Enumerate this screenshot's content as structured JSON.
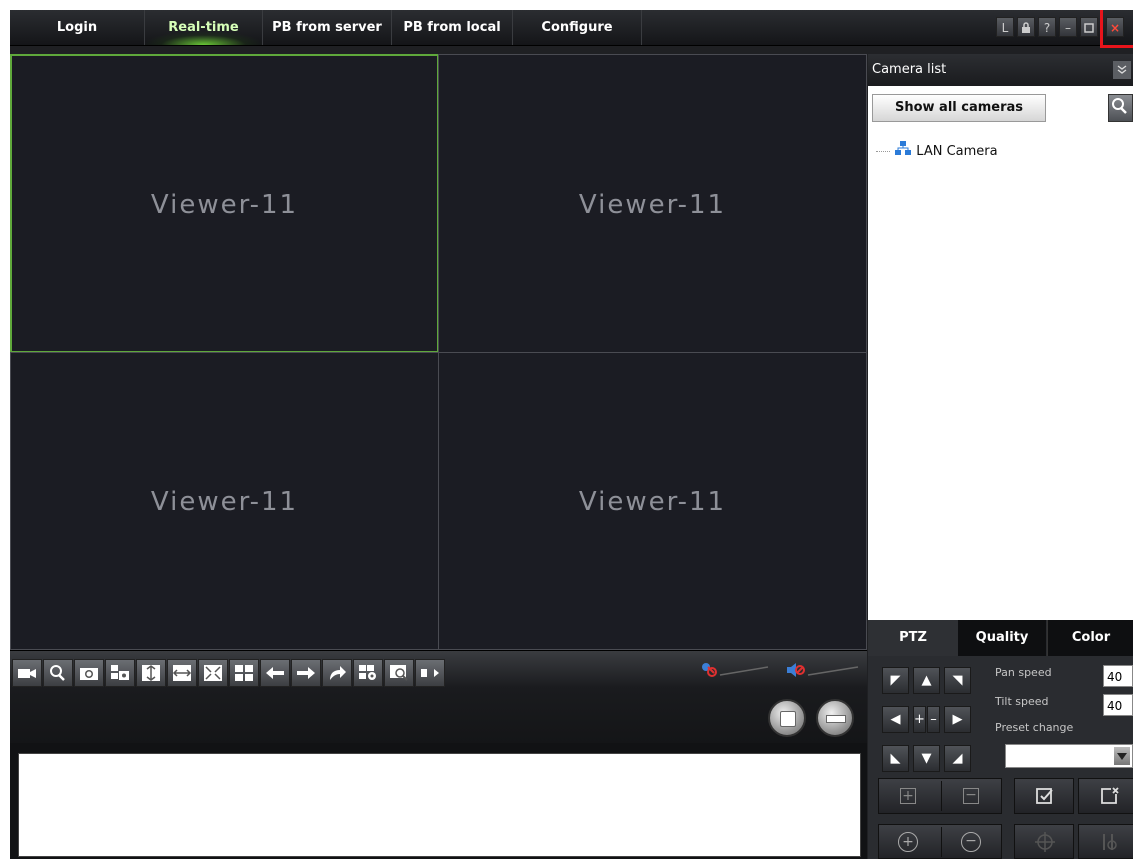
{
  "menu": {
    "tabs": [
      {
        "label": "Login"
      },
      {
        "label": "Real-time"
      },
      {
        "label": "PB from server"
      },
      {
        "label": "PB from local"
      },
      {
        "label": "Configure"
      }
    ],
    "active_tab": "Real-time",
    "window_buttons": {
      "lock_label": "L",
      "help_label": "?",
      "min_label": "–",
      "close_label": "×"
    }
  },
  "video": {
    "panes": [
      {
        "label": "Viewer-11",
        "selected": true
      },
      {
        "label": "Viewer-11",
        "selected": false
      },
      {
        "label": "Viewer-11",
        "selected": false
      },
      {
        "label": "Viewer-11",
        "selected": false
      }
    ]
  },
  "camera_list": {
    "title": "Camera list",
    "show_all_label": "Show all cameras",
    "tree": [
      {
        "label": "LAN Camera"
      }
    ]
  },
  "panel_tabs": [
    {
      "label": "PTZ"
    },
    {
      "label": "Quality"
    },
    {
      "label": "Color"
    }
  ],
  "ptz": {
    "pan_speed_label": "Pan speed",
    "pan_speed_value": "40",
    "tilt_speed_label": "Tilt speed",
    "tilt_speed_value": "40",
    "preset_label": "Preset change",
    "zoom_plus": "+",
    "zoom_minus": "–"
  },
  "colors": {
    "accent_green": "#5fa83b",
    "close_highlight": "#e8141b",
    "background": "#1f2023"
  }
}
